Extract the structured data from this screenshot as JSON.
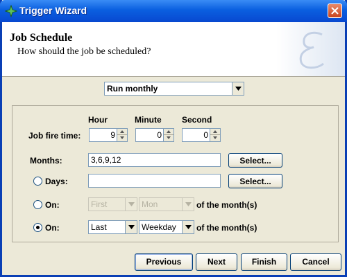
{
  "window": {
    "title": "Trigger Wizard"
  },
  "header": {
    "title": "Job Schedule",
    "subtitle": "How should the job be scheduled?"
  },
  "schedule_type": {
    "value": "Run monthly"
  },
  "time_columns": {
    "hour": "Hour",
    "minute": "Minute",
    "second": "Second"
  },
  "fire_time": {
    "label": "Job fire time:",
    "hour": "9",
    "minute": "0",
    "second": "0"
  },
  "months": {
    "label": "Months:",
    "value": "3,6,9,12",
    "select_label": "Select..."
  },
  "days": {
    "label": "Days:",
    "value": "",
    "select_label": "Select...",
    "selected": false
  },
  "on_first": {
    "label": "On:",
    "ordinal": "First",
    "day": "Mon",
    "suffix": "of the month(s)",
    "selected": false,
    "enabled": false
  },
  "on_last": {
    "label": "On:",
    "ordinal": "Last",
    "day": "Weekday",
    "suffix": "of the month(s)",
    "selected": true,
    "enabled": true
  },
  "buttons": {
    "previous": "Previous",
    "next": "Next",
    "finish": "Finish",
    "cancel": "Cancel"
  },
  "colors": {
    "title_bar": "#0a5fe0",
    "window_border": "#0a3fb5",
    "dialog_bg": "#ece9d8",
    "disabled_text": "#b5b2a2"
  }
}
